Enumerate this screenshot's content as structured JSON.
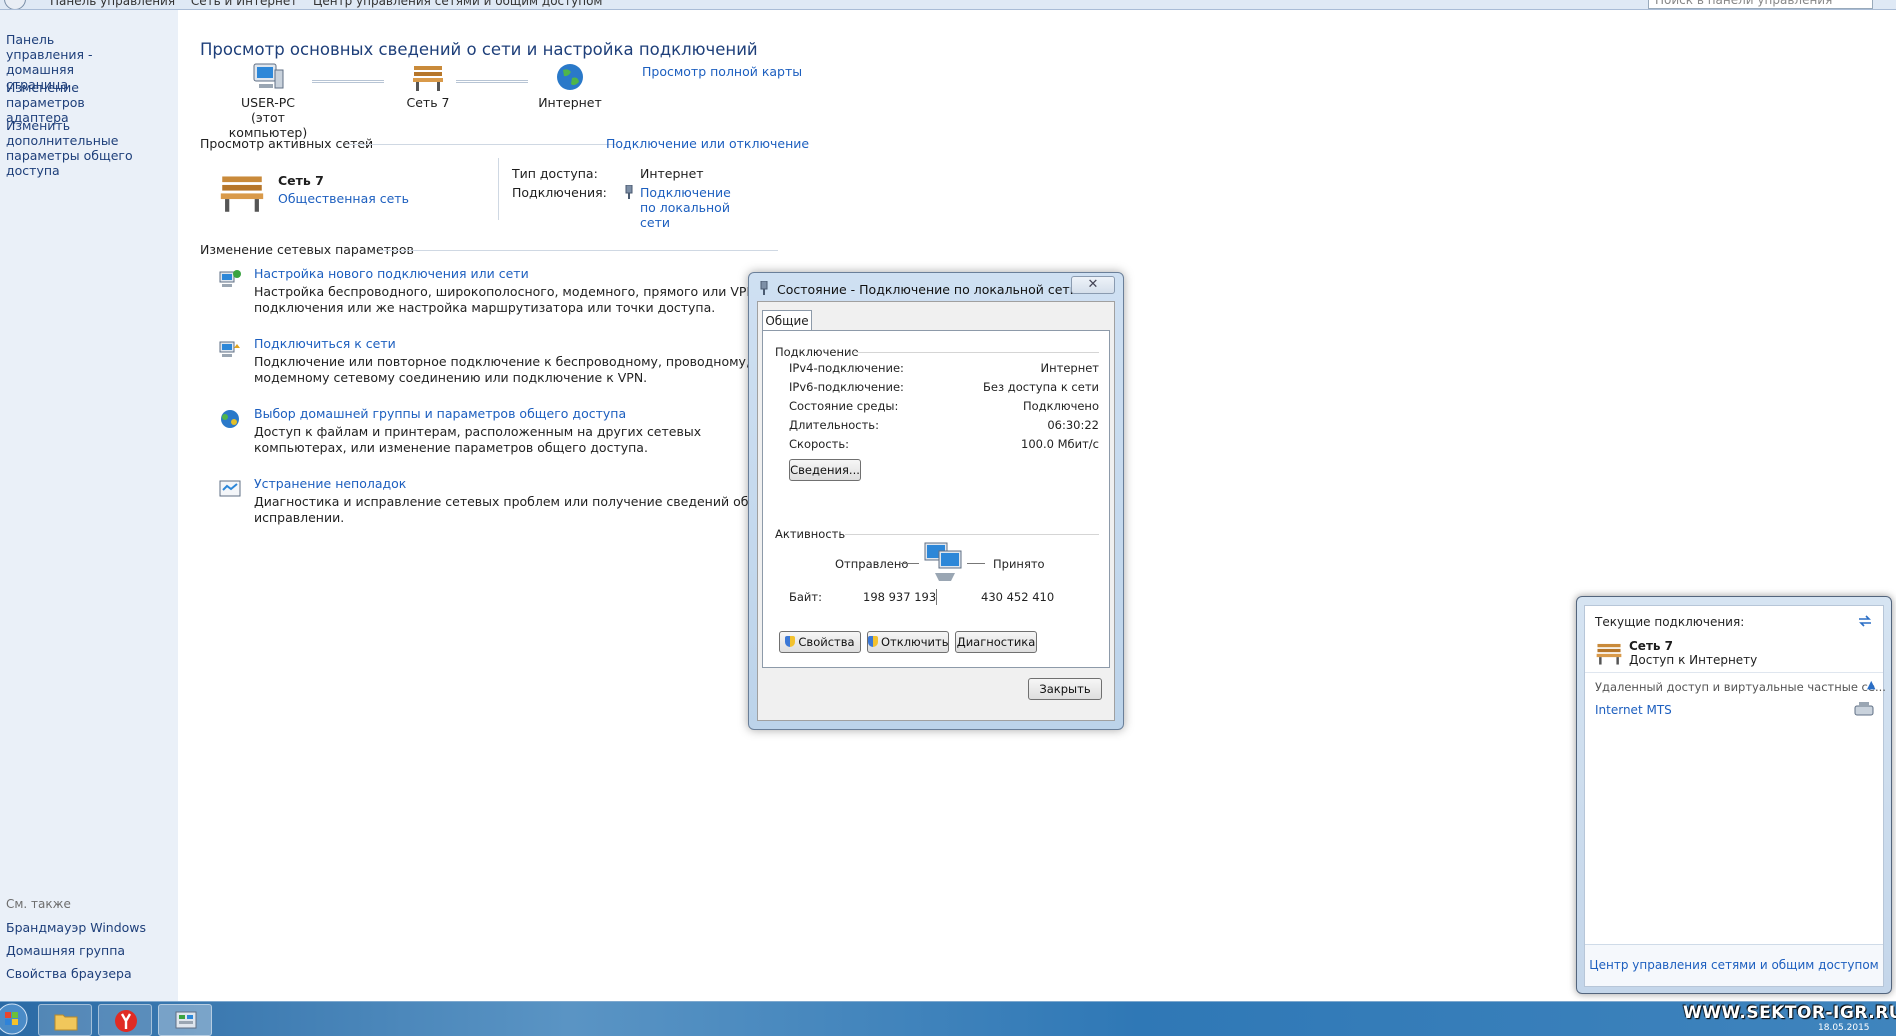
{
  "address_bar": {
    "crumbs": [
      "Панель управления",
      "Сеть и Интернет",
      "Центр управления сетями и общим доступом"
    ],
    "search_placeholder": "Поиск в панели управления"
  },
  "sidebar": {
    "items": [
      "Панель управления - домашняя страница",
      "Изменение параметров адаптера",
      "Изменить дополнительные параметры общего доступа"
    ],
    "see_also_label": "См. также",
    "see_also": [
      "Брандмауэр Windows",
      "Домашняя группа",
      "Свойства браузера"
    ]
  },
  "main": {
    "title": "Просмотр основных сведений о сети и настройка подключений",
    "full_map_link": "Просмотр полной карты",
    "map": {
      "computer_name": "USER-PC",
      "computer_sub": "(этот компьютер)",
      "network_name": "Сеть 7",
      "internet_label": "Интернет"
    },
    "active_networks": {
      "heading": "Просмотр активных сетей",
      "connect_link": "Подключение или отключение",
      "network_name": "Сеть 7",
      "network_type": "Общественная сеть",
      "access_type_label": "Тип доступа:",
      "access_type_value": "Интернет",
      "connections_label": "Подключения:",
      "connections_value": "Подключение по локальной сети"
    },
    "change_settings": {
      "heading": "Изменение сетевых параметров",
      "tasks": [
        {
          "link": "Настройка нового подключения или сети",
          "desc": "Настройка беспроводного, широкополосного, модемного, прямого или VPN-подключения или же настройка маршрутизатора или точки доступа."
        },
        {
          "link": "Подключиться к сети",
          "desc": "Подключение или повторное подключение к беспроводному, проводному, модемному сетевому соединению или подключение к VPN."
        },
        {
          "link": "Выбор домашней группы и параметров общего доступа",
          "desc": "Доступ к файлам и принтерам, расположенным на других сетевых компьютерах, или изменение параметров общего доступа."
        },
        {
          "link": "Устранение неполадок",
          "desc": "Диагностика и исправление сетевых проблем или получение сведений об исправлении."
        }
      ]
    }
  },
  "dialog": {
    "title": "Состояние - Подключение по локальной сети",
    "tab": "Общие",
    "connection_group": "Подключение",
    "rows": [
      {
        "label": "IPv4-подключение:",
        "value": "Интернет"
      },
      {
        "label": "IPv6-подключение:",
        "value": "Без доступа к сети"
      },
      {
        "label": "Состояние среды:",
        "value": "Подключено"
      },
      {
        "label": "Длительность:",
        "value": "06:30:22"
      },
      {
        "label": "Скорость:",
        "value": "100.0 Мбит/с"
      }
    ],
    "details_button": "Сведения...",
    "activity_group": "Активность",
    "sent_label": "Отправлено",
    "received_label": "Принято",
    "bytes_label": "Байт:",
    "bytes_sent": "198 937 193",
    "bytes_received": "430 452 410",
    "buttons": {
      "properties": "Свойства",
      "disable": "Отключить",
      "diagnose": "Диагностика"
    },
    "close_button": "Закрыть"
  },
  "flyout": {
    "header": "Текущие подключения:",
    "network_name": "Сеть 7",
    "network_status": "Доступ к Интернету",
    "vpn_section": "Удаленный доступ и виртуальные частные се...",
    "vpn_item": "Internet MTS",
    "footer_link": "Центр управления сетями и общим доступом"
  },
  "taskbar": {
    "watermark": "WWW.SEKTOR-IGR.RU",
    "date": "18.05.2015"
  }
}
